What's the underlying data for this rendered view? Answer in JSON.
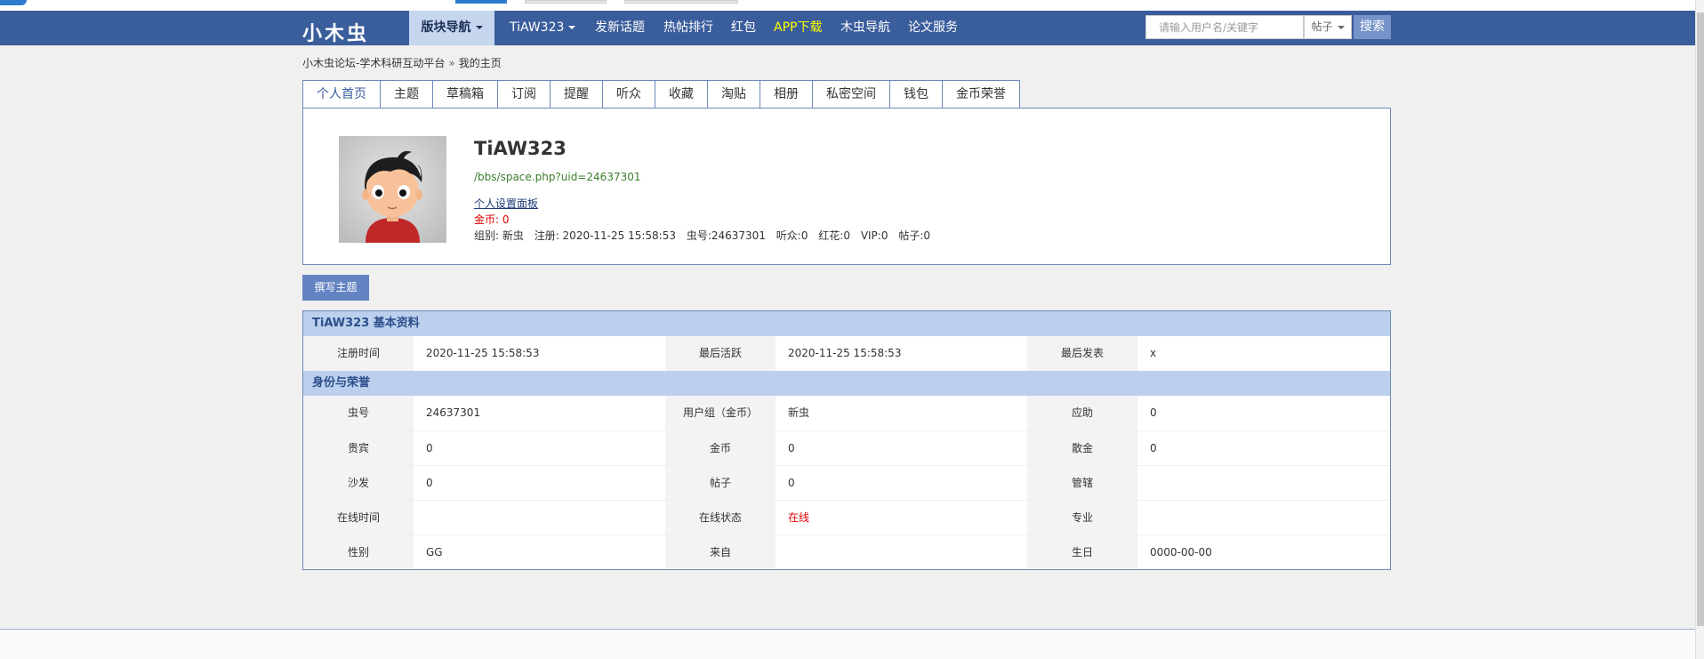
{
  "colors": {
    "nav_bg": "#3a5d9c",
    "nav_active_bg": "#c6d6ef",
    "section_head_bg": "#bcd0ee",
    "app_download_color": "#ffff00",
    "online_color": "#e00000"
  },
  "header": {
    "logo": "小木虫",
    "nav": [
      {
        "label": "版块导航"
      },
      {
        "label": "TiAW323"
      },
      {
        "label": "发新话题"
      },
      {
        "label": "热帖排行"
      },
      {
        "label": "红包"
      },
      {
        "label": "APP下载"
      },
      {
        "label": "木虫导航"
      },
      {
        "label": "论文服务"
      }
    ],
    "search": {
      "placeholder": "请输入用户名/关键字",
      "type": "帖子",
      "button": "搜索"
    }
  },
  "breadcrumb": {
    "site": "小木虫论坛-学术科研互动平台",
    "separator": "»",
    "current": "我的主页"
  },
  "tabs": [
    "个人首页",
    "主题",
    "草稿箱",
    "订阅",
    "提醒",
    "听众",
    "收藏",
    "淘贴",
    "相册",
    "私密空间",
    "钱包",
    "金币荣誉"
  ],
  "profile": {
    "username": "TiAW323",
    "url": "/bbs/space.php?uid=24637301",
    "settings_link": "个人设置面板",
    "coins": "金币: 0",
    "stats": [
      "组别: 新虫",
      "注册: 2020-11-25 15:58:53",
      "虫号:24637301",
      "听众:0",
      "红花:0",
      "VIP:0",
      "帖子:0"
    ]
  },
  "write_button": "撰写主题",
  "basic_info": {
    "title": "TiAW323 基本资料",
    "row": {
      "l1": "注册时间",
      "v1": "2020-11-25 15:58:53",
      "l2": "最后活跃",
      "v2": "2020-11-25 15:58:53",
      "l3": "最后发表",
      "v3": "x"
    }
  },
  "identity": {
    "title": "身份与荣誉",
    "rows": [
      {
        "l1": "虫号",
        "v1": "24637301",
        "l2": "用户组（金币）",
        "v2": "新虫",
        "l3": "应助",
        "v3": "0"
      },
      {
        "l1": "贵宾",
        "v1": "0",
        "l2": "金币",
        "v2": "0",
        "l3": "散金",
        "v3": "0"
      },
      {
        "l1": "沙发",
        "v1": "0",
        "l2": "帖子",
        "v2": "0",
        "l3": "管辖",
        "v3": ""
      },
      {
        "l1": "在线时间",
        "v1": "",
        "l2": "在线状态",
        "v2": "在线",
        "l3": "专业",
        "v3": ""
      },
      {
        "l1": "性别",
        "v1": "GG",
        "l2": "来自",
        "v2": "",
        "l3": "生日",
        "v3": "0000-00-00"
      }
    ]
  }
}
